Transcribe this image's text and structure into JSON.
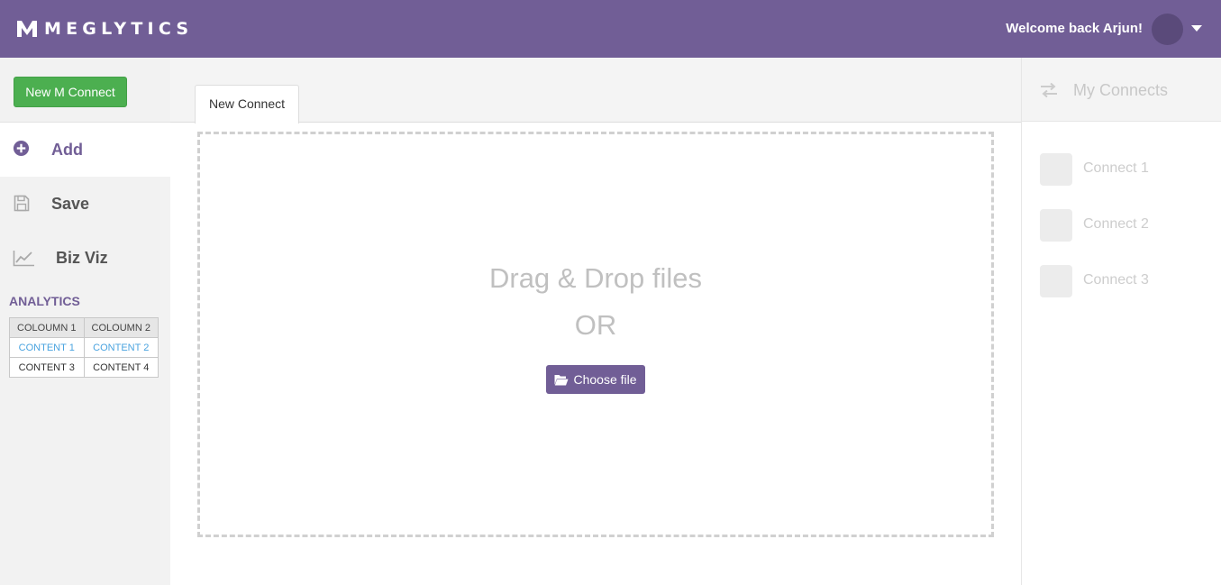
{
  "header": {
    "logo_text": "MEGLYTICS",
    "welcome": "Welcome back Arjun!",
    "brand_color": "#715e96"
  },
  "sidebar": {
    "new_button": "New M Connect",
    "items": [
      {
        "label": "Add",
        "icon": "plus-circle-icon",
        "active": true
      },
      {
        "label": "Save",
        "icon": "floppy-disk-icon",
        "active": false
      },
      {
        "label": "Biz Viz",
        "icon": "line-chart-icon",
        "active": false
      }
    ],
    "analytics": {
      "title": "ANALYTICS",
      "columns": [
        "COLOUMN 1",
        "COLOUMN 2"
      ],
      "rows": [
        [
          "CONTENT 1",
          "CONTENT 2"
        ],
        [
          "CONTENT 3",
          "CONTENT 4"
        ]
      ]
    }
  },
  "main": {
    "tab": "New Connect",
    "dropzone": {
      "title": "Drag & Drop files",
      "or": "OR",
      "button": "Choose file"
    }
  },
  "connects": {
    "title": "My Connects",
    "items": [
      "Connect 1",
      "Connect 2",
      "Connect 3"
    ]
  }
}
